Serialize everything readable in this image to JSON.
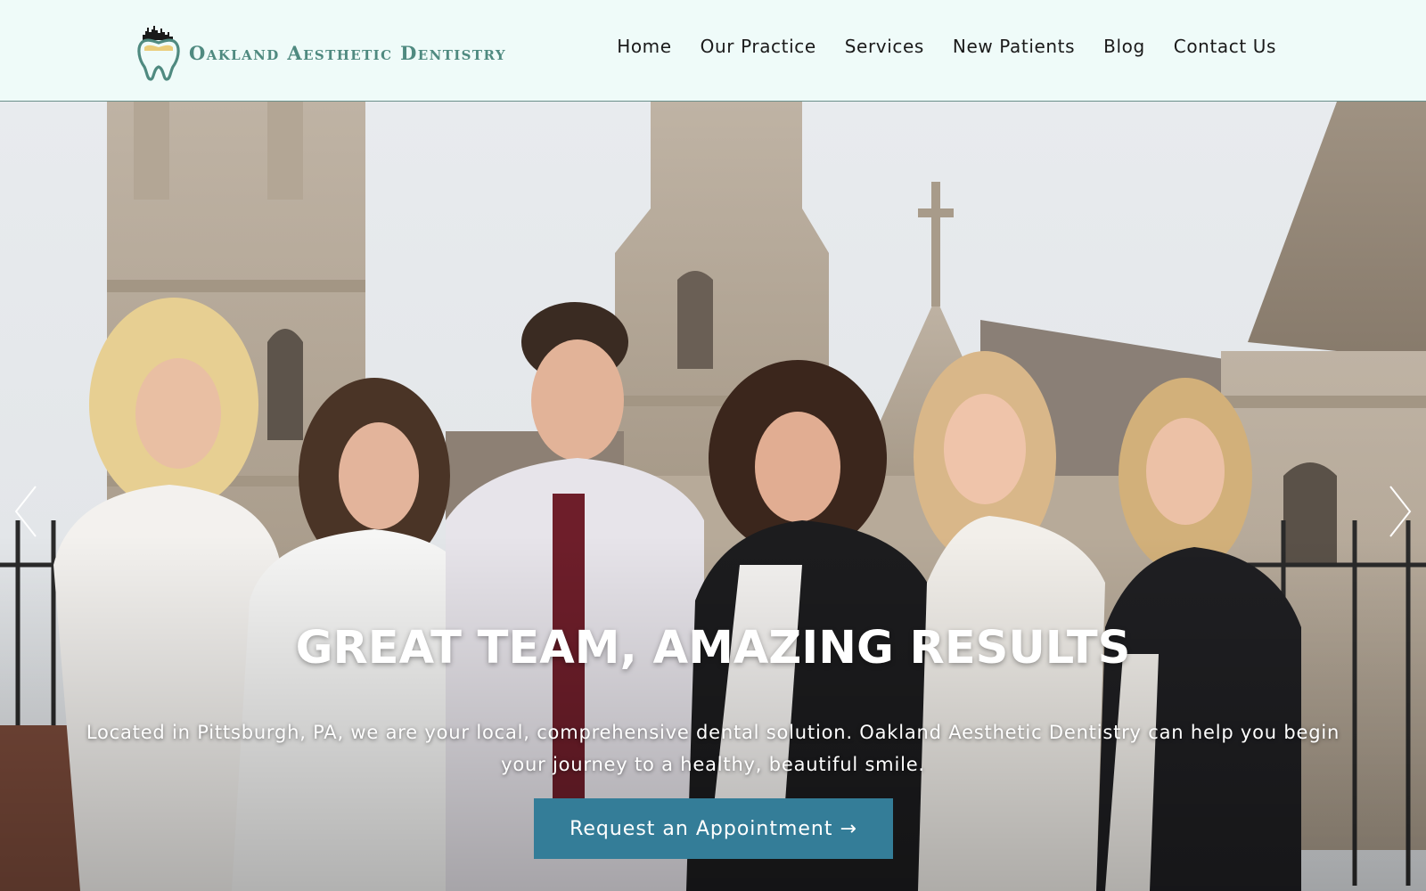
{
  "brand": {
    "name": "Oakland Aesthetic Dentistry",
    "logo_icon": "tooth-skyline-icon",
    "color": "#4f8a80"
  },
  "nav": {
    "items": [
      {
        "label": "Home"
      },
      {
        "label": "Our Practice"
      },
      {
        "label": "Services"
      },
      {
        "label": "New Patients"
      },
      {
        "label": "Blog"
      },
      {
        "label": "Contact Us"
      }
    ]
  },
  "hero": {
    "title": "GREAT TEAM, AMAZING RESULTS",
    "subtitle": "Located in Pittsburgh, PA, we are your local, comprehensive dental solution. Oakland Aesthetic Dentistry can help you begin your journey to a healthy, beautiful smile.",
    "cta_label": "Request an Appointment →",
    "cta_color": "#347d98",
    "prev_icon": "chevron-left-icon",
    "next_icon": "chevron-right-icon",
    "image": "team-photo-in-front-of-cathedral"
  }
}
